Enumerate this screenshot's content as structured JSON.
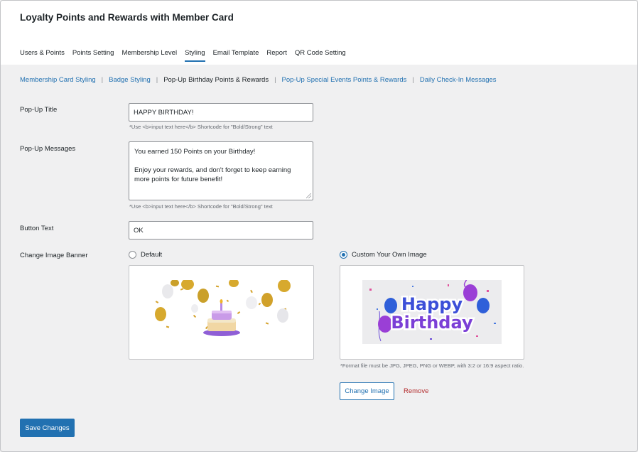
{
  "app": {
    "title": "Loyalty Points and Rewards with Member Card"
  },
  "main_tabs": [
    {
      "label": "Users & Points"
    },
    {
      "label": "Points Setting"
    },
    {
      "label": "Membership Level"
    },
    {
      "label": "Styling"
    },
    {
      "label": "Email Template"
    },
    {
      "label": "Report"
    },
    {
      "label": "QR Code Setting"
    }
  ],
  "active_main_tab": "Styling",
  "sub_tabs": [
    {
      "label": "Membership Card Styling"
    },
    {
      "label": "Badge Styling"
    },
    {
      "label": "Pop-Up Birthday Points & Rewards"
    },
    {
      "label": "Pop-Up Special Events Points & Rewards"
    },
    {
      "label": "Daily Check-In Messages"
    }
  ],
  "sub_separator": "|",
  "active_sub_tab": "Pop-Up Birthday Points & Rewards",
  "form": {
    "popup_title": {
      "label": "Pop-Up Title",
      "value": "HAPPY BIRTHDAY!",
      "hint": "*Use <b>input text here</b> Shortcode for \"Bold/Strong\" text"
    },
    "popup_messages": {
      "label": "Pop-Up Messages",
      "line1": "You earned 150 Points on your Birthday!",
      "line2": "Enjoy your rewards, and don't forget to keep earning more points for future benefit!",
      "hint": "*Use <b>input text here</b> Shortcode for \"Bold/Strong\" text"
    },
    "button_text": {
      "label": "Button Text",
      "value": "OK"
    },
    "image_banner": {
      "label": "Change Image Banner",
      "default_option": "Default",
      "custom_option": "Custom Your Own Image",
      "selected": "custom",
      "custom_image_text_1": "Happy",
      "custom_image_text_2": "Birthday",
      "format_note": "*Format file must be JPG, JPEG, PNG or WEBP, with 3:2 or 16:9 aspect ratio.",
      "change_button": "Change Image",
      "remove_link": "Remove"
    }
  },
  "save_button": "Save Changes",
  "colors": {
    "accent": "#2271b1",
    "danger": "#b32d2e",
    "page_bg": "#f0f0f1",
    "text": "#1d2327",
    "muted": "#646970"
  }
}
